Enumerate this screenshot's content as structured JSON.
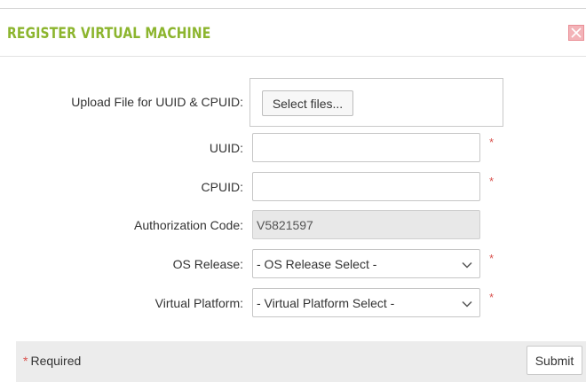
{
  "dialog": {
    "title": "REGISTER VIRTUAL MACHINE",
    "close_icon": "close-icon"
  },
  "form": {
    "upload": {
      "label": "Upload File for UUID & CPUID:",
      "button_label": "Select files..."
    },
    "uuid": {
      "label": "UUID:",
      "value": "",
      "required_mark": "*"
    },
    "cpuid": {
      "label": "CPUID:",
      "value": "",
      "required_mark": "*"
    },
    "authorization": {
      "label": "Authorization Code:",
      "value": "V5821597"
    },
    "os_release": {
      "label": "OS Release:",
      "selected": "- OS Release Select -",
      "required_mark": "*"
    },
    "virtual_platform": {
      "label": "Virtual Platform:",
      "selected": "- Virtual Platform Select -",
      "required_mark": "*"
    }
  },
  "footer": {
    "required_star": "*",
    "required_text": "Required",
    "submit_label": "Submit"
  },
  "colors": {
    "title": "#8cb52e",
    "required": "#d9534f",
    "close_bg": "#f3b3b8",
    "disabled_bg": "#e8e8e8",
    "footer_bg": "#ececec"
  }
}
